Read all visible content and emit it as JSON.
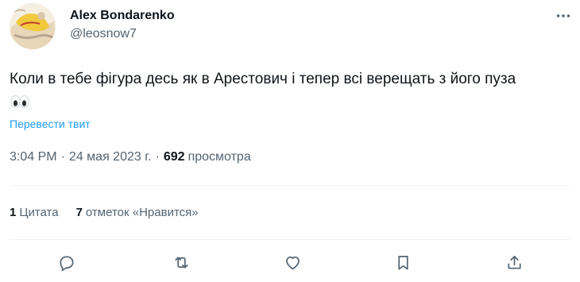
{
  "author": {
    "display_name": "Alex Bondarenko",
    "handle": "@leosnow7",
    "avatar_icon": "user-avatar"
  },
  "tweet": {
    "text": "Коли в тебе фігура десь як в Арестович і тепер всі верещать з його пуза",
    "emoji": "👀",
    "translate_label": "Перевести твит"
  },
  "meta": {
    "time": "3:04 PM",
    "separator": "·",
    "date": "24 мая 2023 г.",
    "views_count": "692",
    "views_label": "просмотра"
  },
  "stats": {
    "quotes_count": "1",
    "quotes_label": "Цитата",
    "likes_count": "7",
    "likes_label": "отметок «Нравится»"
  },
  "actions": [
    "reply-icon",
    "retweet-icon",
    "like-icon",
    "bookmark-icon",
    "share-icon"
  ],
  "colors": {
    "text": "#0f1419",
    "secondary": "#536471",
    "link": "#1d9bf0",
    "divider": "#eff3f4"
  }
}
